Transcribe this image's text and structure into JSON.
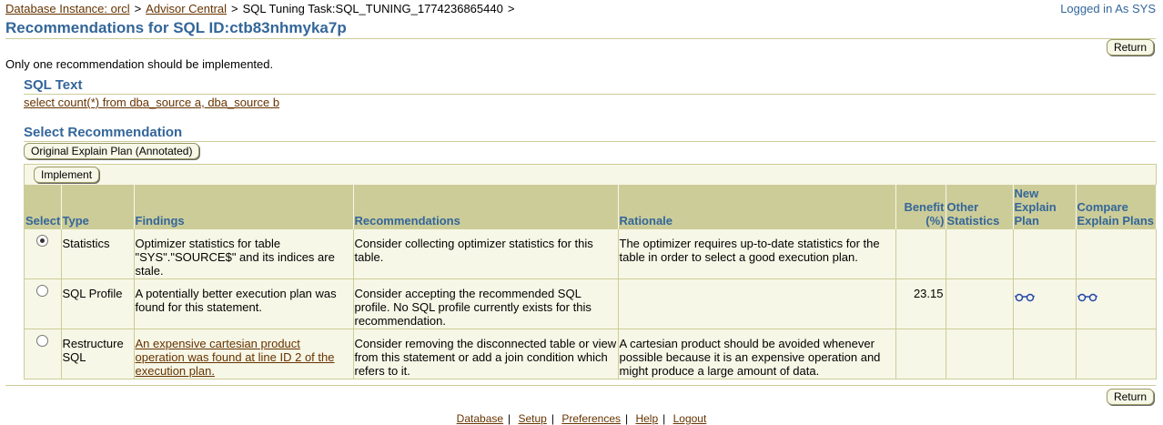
{
  "breadcrumb": {
    "items": [
      "Database Instance: orcl",
      "Advisor Central"
    ],
    "current": "SQL Tuning Task:SQL_TUNING_1774236865440",
    "separator": ">"
  },
  "login_status": "Logged in As SYS",
  "page_title": "Recommendations for SQL ID:ctb83nhmyka7p",
  "return_label": "Return",
  "note": "Only one recommendation should be implemented.",
  "sql_section": {
    "title": "SQL Text",
    "sql": "select count(*) from dba_source a, dba_source b"
  },
  "select_section": {
    "title": "Select Recommendation",
    "explain_button": "Original Explain Plan (Annotated)",
    "implement_button": "Implement"
  },
  "table": {
    "headers": {
      "select": "Select",
      "type": "Type",
      "findings": "Findings",
      "recommendations": "Recommendations",
      "rationale": "Rationale",
      "benefit": "Benefit (%)",
      "other_statistics": "Other Statistics",
      "new_explain_plan": "New Explain Plan",
      "compare_explain_plans": "Compare Explain Plans"
    },
    "rows": [
      {
        "selected": true,
        "type": "Statistics",
        "findings": "Optimizer statistics for table \"SYS\".\"SOURCE$\" and its indices are stale.",
        "recommendation": "Consider collecting optimizer statistics for this table.",
        "rationale": "The optimizer requires up-to-date statistics for the table in order to select a good execution plan.",
        "benefit": "",
        "new_plan_icon": "",
        "compare_icon": ""
      },
      {
        "selected": false,
        "type": "SQL Profile",
        "findings": "A potentially better execution plan was found for this statement.",
        "recommendation": "Consider accepting the recommended SQL profile. No SQL profile currently exists for this recommendation.",
        "rationale": "",
        "benefit": "23.15",
        "new_plan_icon": "glasses-icon",
        "compare_icon": "glasses-icon"
      },
      {
        "selected": false,
        "type": "Restructure SQL",
        "findings": "An expensive cartesian product operation was found at line ID 2 of the execution plan.",
        "recommendation": "Consider removing the disconnected table or view from this statement or add a join condition which refers to it.",
        "rationale": "A cartesian product should be avoided whenever possible because it is an expensive operation and might produce a large amount of data.",
        "benefit": "",
        "new_plan_icon": "",
        "compare_icon": ""
      }
    ]
  },
  "footer_links": [
    "Database",
    "Setup",
    "Preferences",
    "Help",
    "Logout"
  ],
  "colors": {
    "title_blue": "#336699",
    "link_brown": "#663300",
    "header_bg": "#cccc99",
    "row_bg": "#f7f7e7"
  }
}
